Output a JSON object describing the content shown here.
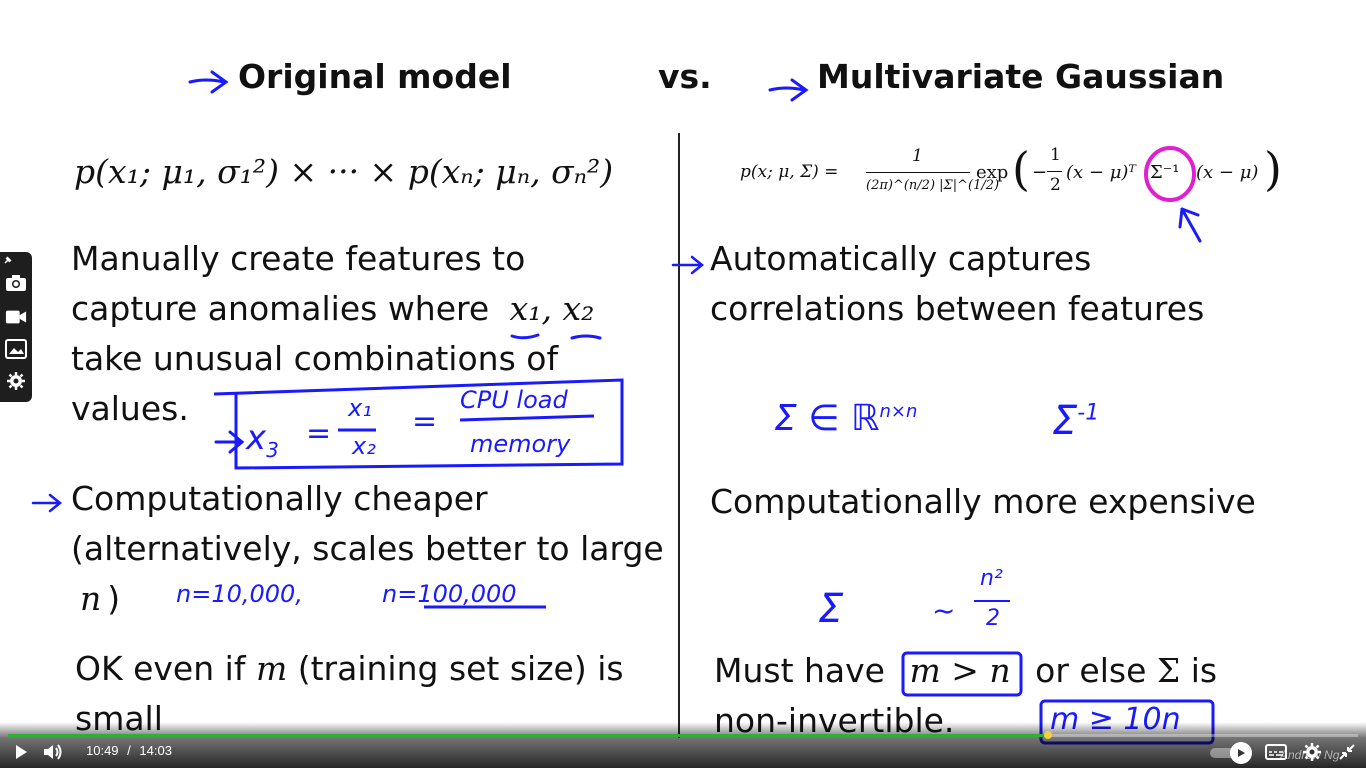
{
  "slide": {
    "left_heading": "Original model",
    "vs_label": "vs.",
    "right_heading": "Multivariate Gaussian",
    "left_formula": "p(x₁; μ₁, σ₁²) × ··· × p(xₙ; μₙ, σₙ²)",
    "right_formula_lhs": "p(x; μ, Σ) =",
    "right_formula_numerator": "1",
    "right_formula_denominator": "(2π)^(n/2) |Σ|^(1/2)",
    "right_formula_exp": "exp",
    "right_formula_body": "(x − μ)ᵀ",
    "right_formula_sigma_inv": "Σ⁻¹",
    "right_formula_tail": "(x − μ)",
    "right_formula_half": "1",
    "right_formula_half_den": "2",
    "left_point1_line1": "Manually create features to",
    "left_point1_line2a": "capture anomalies where",
    "left_point1_line2_math": "x₁, x₂",
    "left_point1_line3": "take unusual combinations of",
    "left_point1_line4": "values.",
    "left_point2_line1": "Computationally cheaper",
    "left_point2_line2": "(alternatively, scales better to large",
    "left_point2_line3_math": "n",
    "left_point2_line3_paren": ")",
    "left_point3_line1a": "OK even if",
    "left_point3_line1_math": "m",
    "left_point3_line1b": "(training set size) is",
    "left_point3_line2": "small",
    "right_point1_line1": "Automatically captures",
    "right_point1_line2": "correlations between features",
    "right_point2": "Computationally more expensive",
    "right_point3_line1a": "Must have",
    "right_point3_line1_math": "m > n",
    "right_point3_line1b": "or else",
    "right_point3_line1_sigma": "Σ",
    "right_point3_line1c": "is",
    "right_point3_line2": "non-invertible."
  },
  "annotations": {
    "x3_lhs": "x",
    "x3_sub": "3",
    "x3_eq": "=",
    "x3_num": "x₁",
    "x3_den": "x₂",
    "x3_eq2": "=",
    "x3_rnum": "CPU load",
    "x3_rden": "memory",
    "n_10k": "n=10,000,",
    "n_100k": "n=100,000",
    "sigma_in_r": "Σ ∈ ℝ",
    "sigma_in_r_sup": "n×n",
    "sigma_inv": "Σ",
    "sigma_inv_sup": "-1",
    "sigma_small": "Σ",
    "approx": "~",
    "n2_num": "n²",
    "n2_den": "2",
    "m_ge_10n": "m ≥ 10n"
  },
  "player": {
    "current_time": "10:49",
    "separator": "/",
    "duration": "14:03",
    "progress_fraction": 0.77,
    "watermark": "Andrew Ng",
    "accent_color": "#2fae3a",
    "ink_color": "#1a1aff",
    "highlight_color": "#e020d0"
  },
  "icons": {
    "play": "play-icon",
    "volume": "volume-icon",
    "autoplay": "autoplay-toggle-icon",
    "captions": "captions-icon",
    "settings": "gear-icon",
    "fullscreen": "exit-fullscreen-icon",
    "pin": "pin-icon",
    "camera": "camera-icon",
    "video": "video-icon",
    "gallery": "gallery-icon",
    "gear_side": "gear-icon"
  }
}
